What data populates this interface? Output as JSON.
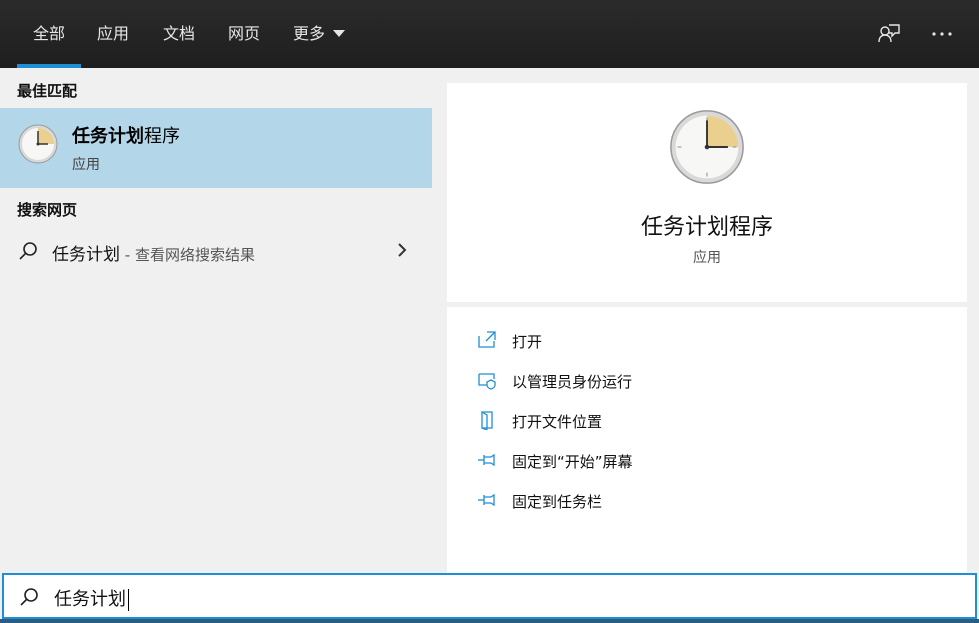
{
  "tabs": [
    {
      "label": "全部",
      "active": true
    },
    {
      "label": "应用",
      "active": false
    },
    {
      "label": "文档",
      "active": false
    },
    {
      "label": "网页",
      "active": false
    },
    {
      "label": "更多",
      "active": false
    }
  ],
  "top_icons": [
    "feedback-icon",
    "more-options-icon"
  ],
  "best_match": {
    "section_title": "最佳匹配",
    "title_bold": "任务计划",
    "title_rest": "程序",
    "subtitle": "应用"
  },
  "web_search": {
    "section_title": "搜索网页",
    "query": "任务计划",
    "hint": " - 查看网络搜索结果"
  },
  "detail": {
    "name": "任务计划程序",
    "type": "应用"
  },
  "actions": [
    {
      "label": "打开",
      "icon": "open-icon"
    },
    {
      "label": "以管理员身份运行",
      "icon": "run-as-admin-icon"
    },
    {
      "label": "打开文件位置",
      "icon": "file-location-icon"
    },
    {
      "label": "固定到“开始”屏幕",
      "icon": "pin-to-start-icon"
    },
    {
      "label": "固定到任务栏",
      "icon": "pin-to-taskbar-icon"
    }
  ],
  "search": {
    "query": "任务计划"
  },
  "colors": {
    "accent": "#1f8fd4",
    "selected_bg": "#b3d6e8",
    "topbar_bg": "#1e1e1e"
  }
}
